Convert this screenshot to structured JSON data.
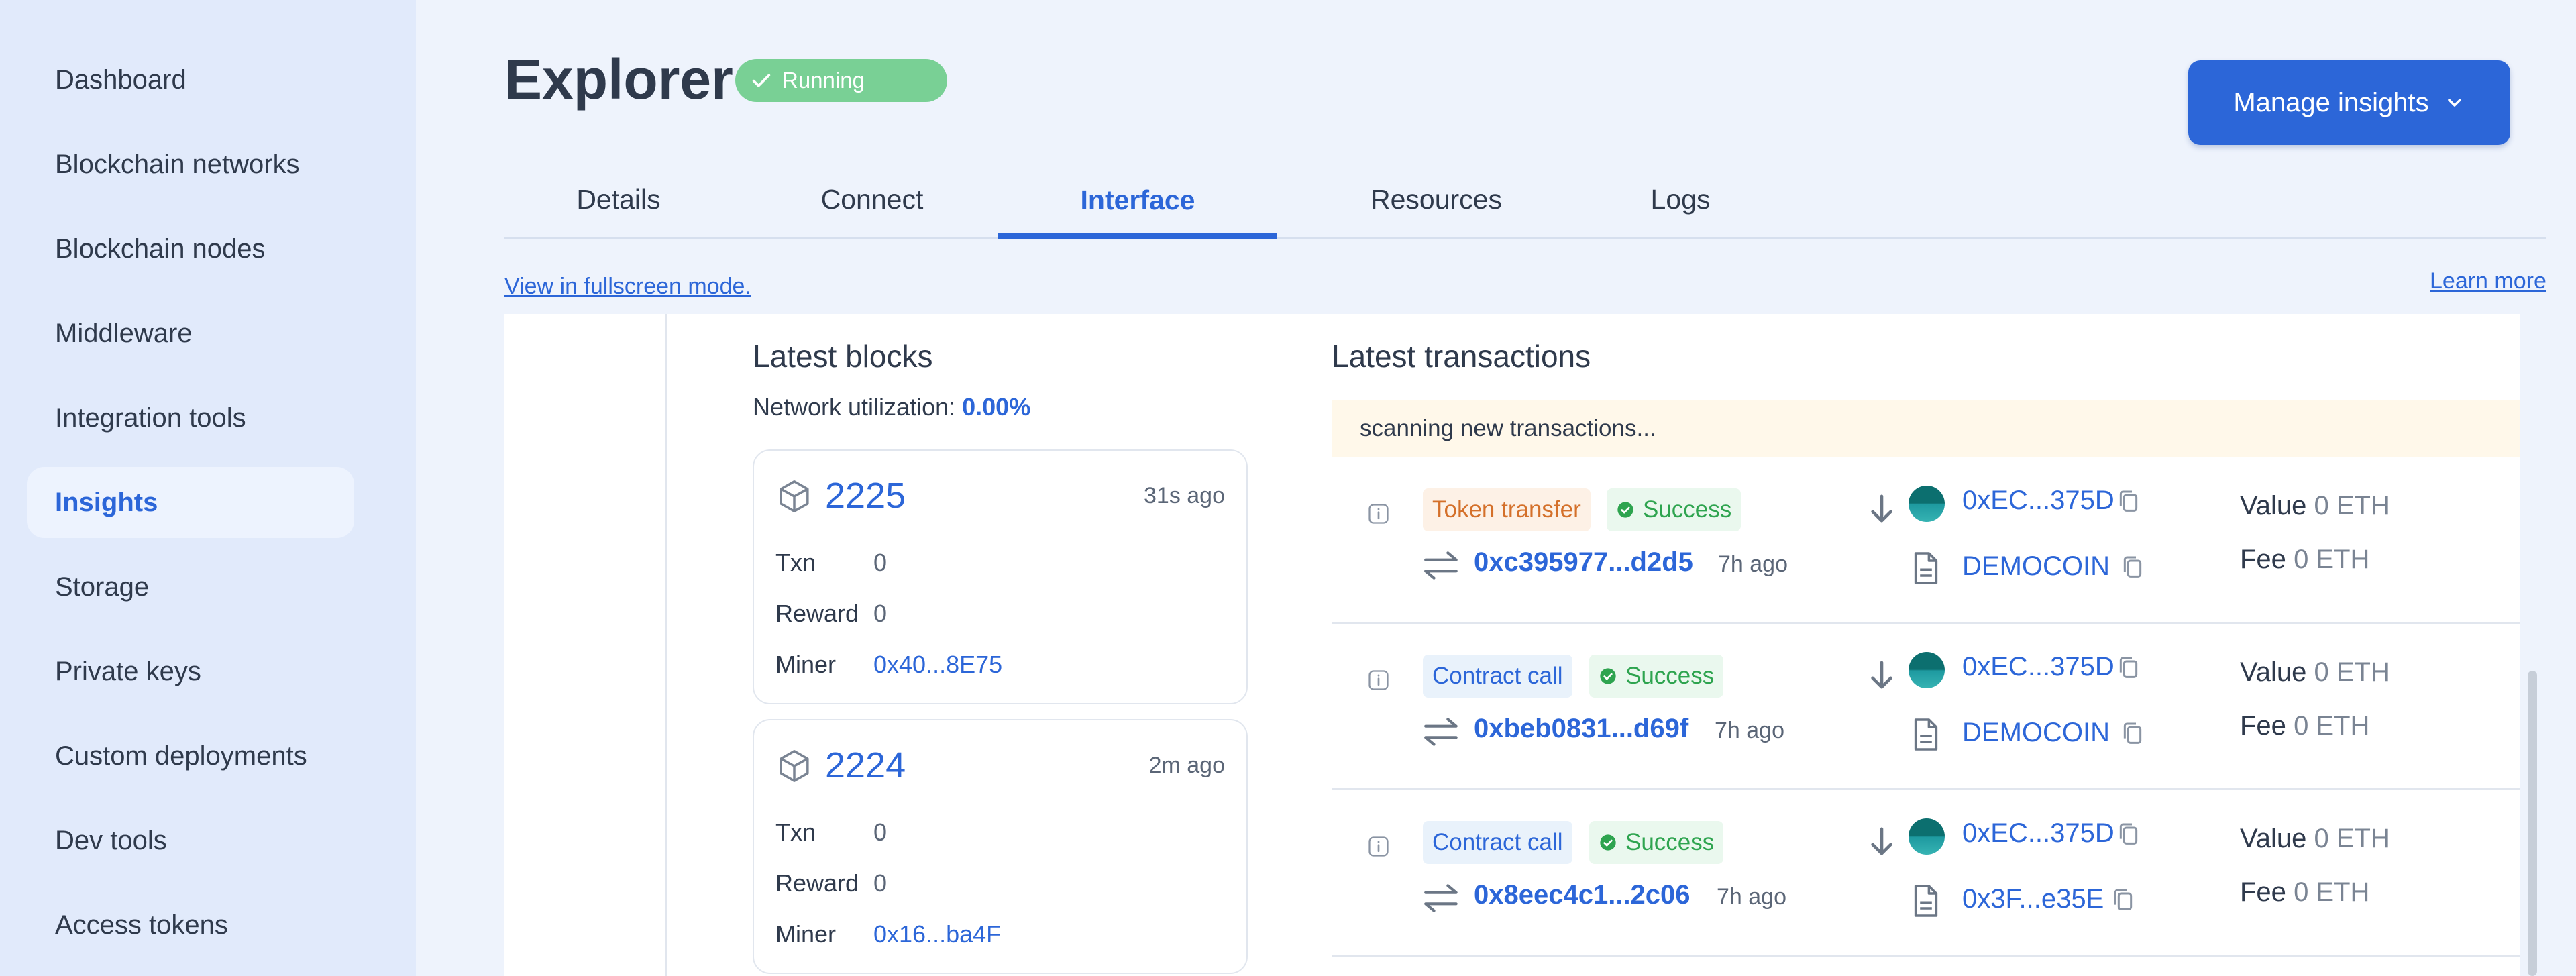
{
  "sidebar": {
    "items": [
      {
        "label": "Dashboard"
      },
      {
        "label": "Blockchain networks"
      },
      {
        "label": "Blockchain nodes"
      },
      {
        "label": "Middleware"
      },
      {
        "label": "Integration tools"
      },
      {
        "label": "Insights",
        "active": true
      },
      {
        "label": "Storage"
      },
      {
        "label": "Private keys"
      },
      {
        "label": "Custom deployments"
      },
      {
        "label": "Dev tools"
      },
      {
        "label": "Access tokens"
      }
    ]
  },
  "header": {
    "title": "Explorer",
    "status": "Running",
    "manage_button": "Manage insights"
  },
  "tabs": [
    {
      "label": "Details"
    },
    {
      "label": "Connect"
    },
    {
      "label": "Interface",
      "active": true
    },
    {
      "label": "Resources"
    },
    {
      "label": "Logs"
    }
  ],
  "links": {
    "fullscreen": "View in fullscreen mode.",
    "learn_more": "Learn more"
  },
  "blocks": {
    "title": "Latest blocks",
    "utilization_label": "Network utilization:",
    "utilization_value": "0.00%",
    "labels": {
      "txn": "Txn",
      "reward": "Reward",
      "miner": "Miner"
    },
    "items": [
      {
        "number": "2225",
        "ago": "31s ago",
        "txn": "0",
        "reward": "0",
        "miner": "0x40...8E75"
      },
      {
        "number": "2224",
        "ago": "2m ago",
        "txn": "0",
        "reward": "0",
        "miner": "0x16...ba4F"
      }
    ]
  },
  "transactions": {
    "title": "Latest transactions",
    "scanning": "scanning new transactions...",
    "value_label": "Value",
    "fee_label": "Fee",
    "items": [
      {
        "type": "Token transfer",
        "status": "Success",
        "hash": "0xc395977...d2d5",
        "ago": "7h ago",
        "from": "0xEC...375D",
        "contract": "DEMOCOIN",
        "value": "0 ETH",
        "fee": "0 ETH"
      },
      {
        "type": "Contract call",
        "status": "Success",
        "hash": "0xbeb0831...d69f",
        "ago": "7h ago",
        "from": "0xEC...375D",
        "contract": "DEMOCOIN",
        "value": "0 ETH",
        "fee": "0 ETH"
      },
      {
        "type": "Contract call",
        "status": "Success",
        "hash": "0x8eec4c1...2c06",
        "ago": "7h ago",
        "from": "0xEC...375D",
        "contract": "0x3F...e35E",
        "value": "0 ETH",
        "fee": "0 ETH"
      }
    ]
  },
  "colors": {
    "accent": "#2c66d8",
    "running": "#79d095",
    "success": "#2ea44f",
    "token_tag": "#d4702a"
  }
}
